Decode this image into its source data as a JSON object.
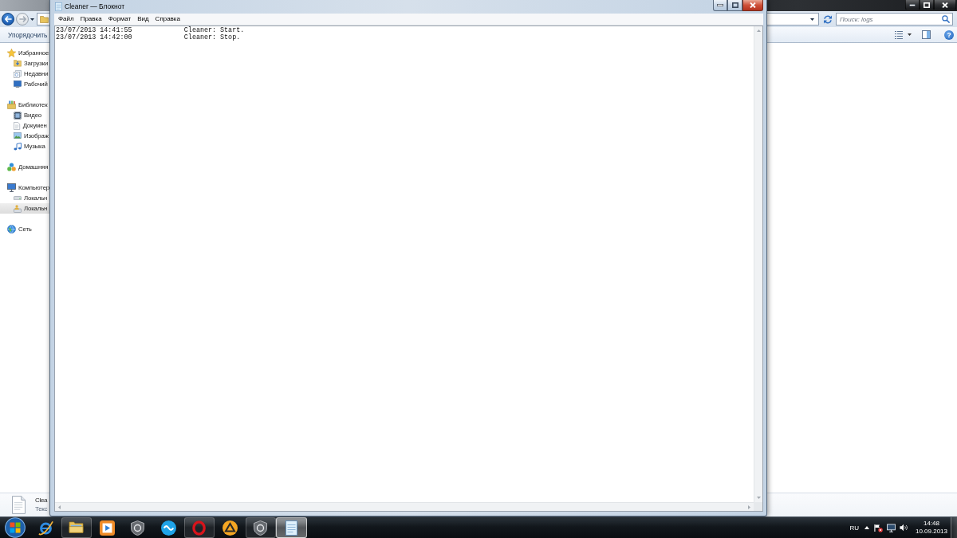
{
  "explorer": {
    "search": {
      "placeholder": "Поиск: logs"
    },
    "toolbar": {
      "organize": "Упорядочить",
      "help": "?"
    },
    "navigation": [
      {
        "label": "Избранное",
        "selected": false,
        "children": [
          {
            "label": "Загрузки",
            "selected": false
          },
          {
            "label": "Недавни",
            "selected": false
          },
          {
            "label": "Рабочий",
            "selected": false
          }
        ]
      },
      {
        "label": "Библиотек",
        "selected": false,
        "children": [
          {
            "label": "Видео",
            "selected": false
          },
          {
            "label": "Докумен",
            "selected": false
          },
          {
            "label": "Изображ",
            "selected": false
          },
          {
            "label": "Музыка",
            "selected": false
          }
        ]
      },
      {
        "label": "Домашняя",
        "selected": false
      },
      {
        "label": "Компьютер",
        "selected": false,
        "children": [
          {
            "label": "Локальн",
            "selected": false
          },
          {
            "label": "Локальн",
            "selected": true
          }
        ]
      },
      {
        "label": "Сеть",
        "selected": false
      }
    ],
    "details": {
      "name": "Clea",
      "type": "Текс"
    }
  },
  "notepad": {
    "title": "Cleaner — Блокнот",
    "menu": [
      "Файл",
      "Правка",
      "Формат",
      "Вид",
      "Справка"
    ],
    "lines": [
      "23/07/2013 14:41:55\t\tCleaner: Start.",
      "23/07/2013 14:42:00\t\tCleaner: Stop."
    ]
  },
  "taskbar": {
    "apps": [
      {
        "running": false,
        "selected": false
      },
      {
        "running": true,
        "selected": false
      },
      {
        "running": false,
        "selected": false
      },
      {
        "running": false,
        "selected": false
      },
      {
        "running": false,
        "selected": false
      },
      {
        "running": true,
        "selected": false
      },
      {
        "running": false,
        "selected": false
      },
      {
        "running": true,
        "selected": false
      },
      {
        "running": true,
        "selected": true
      }
    ],
    "language": "RU",
    "time": "14:48",
    "date": "10.09.2013"
  }
}
